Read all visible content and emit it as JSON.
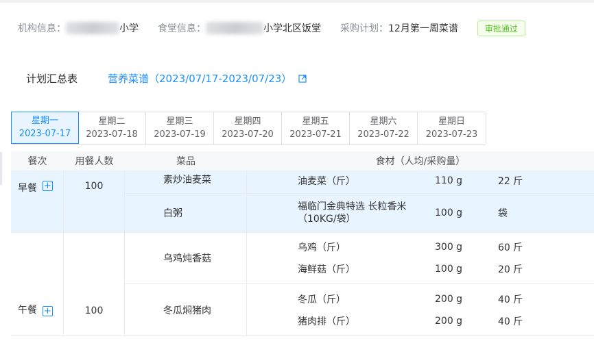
{
  "info": {
    "org_label": "机构信息：",
    "org_value": "小学",
    "canteen_label": "食堂信息：",
    "canteen_value": "小学北区饭堂",
    "plan_label": "采购计划：",
    "plan_value": "12月第一周菜谱",
    "status": "审批通过"
  },
  "header": {
    "title": "计划汇总表",
    "menu_link": "营养菜谱（2023/07/17-2023/07/23）"
  },
  "days": [
    {
      "weekday": "星期一",
      "date": "2023-07-17"
    },
    {
      "weekday": "星期二",
      "date": "2023-07-18"
    },
    {
      "weekday": "星期三",
      "date": "2023-07-19"
    },
    {
      "weekday": "星期四",
      "date": "2023-07-20"
    },
    {
      "weekday": "星期五",
      "date": "2023-07-21"
    },
    {
      "weekday": "星期六",
      "date": "2023-07-22"
    },
    {
      "weekday": "星期日",
      "date": "2023-07-23"
    }
  ],
  "table": {
    "headers": {
      "meal": "餐次",
      "people": "用餐人数",
      "dish": "菜品",
      "ingredients": "食材（人均/采购量）"
    },
    "meals": [
      {
        "name": "早餐",
        "people": "100",
        "dishes": [
          {
            "name": "素炒油麦菜",
            "ingredients": [
              {
                "name": "油麦菜（斤）",
                "per": "110 g",
                "total": "22 斤"
              }
            ]
          },
          {
            "name": "白粥",
            "ingredients": [
              {
                "name": "福临门金典特选 长粒香米（10KG/袋）",
                "per": "100 g",
                "total": "袋"
              }
            ]
          }
        ]
      },
      {
        "name": "午餐",
        "people": "100",
        "dishes": [
          {
            "name": "乌鸡炖香菇",
            "ingredients": [
              {
                "name": "乌鸡（斤）",
                "per": "300 g",
                "total": "60 斤"
              },
              {
                "name": "海鲜菇（斤）",
                "per": "100 g",
                "total": "20 斤"
              }
            ]
          },
          {
            "name": "冬瓜焖猪肉",
            "ingredients": [
              {
                "name": "冬瓜（斤）",
                "per": "200 g",
                "total": "40 斤"
              },
              {
                "name": "猪肉排（斤）",
                "per": "200 g",
                "total": "40 斤"
              }
            ]
          }
        ]
      }
    ]
  }
}
